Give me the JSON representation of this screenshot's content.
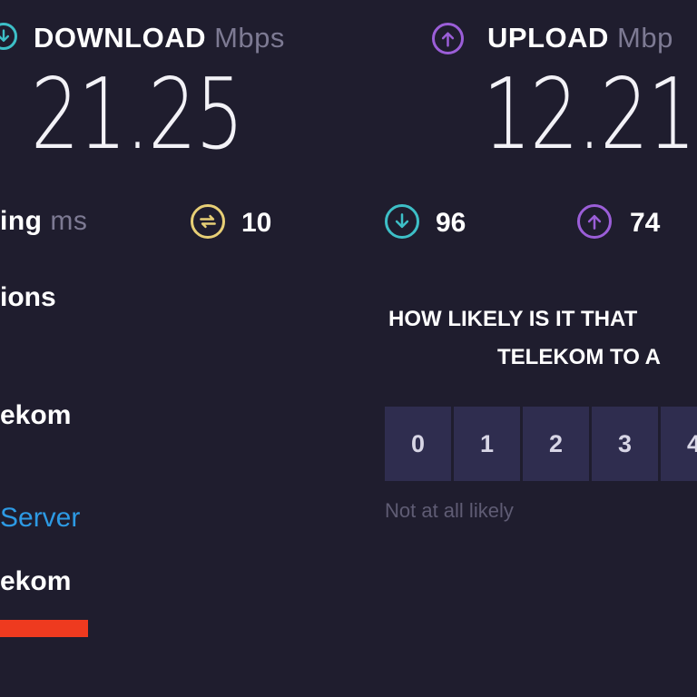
{
  "download": {
    "label": "DOWNLOAD",
    "unit": "Mbps",
    "value": "21.25"
  },
  "upload": {
    "label": "UPLOAD",
    "unit": "Mbp",
    "value": "12.21"
  },
  "ping": {
    "label": "ing",
    "unit": "ms",
    "jitter_value": "10",
    "download_latency": "96",
    "upload_latency": "74"
  },
  "left_panel": {
    "connections_partial": "ions",
    "provider_partial": "ekom",
    "server_link_partial": "Server",
    "server_provider_partial": "ekom"
  },
  "survey": {
    "question_line1": "HOW LIKELY IS IT THAT",
    "question_line2": "TELEKOM TO A",
    "options": [
      "0",
      "1",
      "2",
      "3",
      "4"
    ],
    "hint_low": "Not at all likely"
  },
  "colors": {
    "background": "#1f1d2e",
    "download_accent": "#3dbfc7",
    "upload_accent": "#9b5ed8",
    "jitter_accent": "#e7cf76",
    "link": "#2d9ae4",
    "redaction": "#ee3a1f"
  },
  "icons": {
    "download": "download-arrow-icon",
    "upload": "upload-arrow-icon",
    "jitter": "jitter-icon"
  }
}
